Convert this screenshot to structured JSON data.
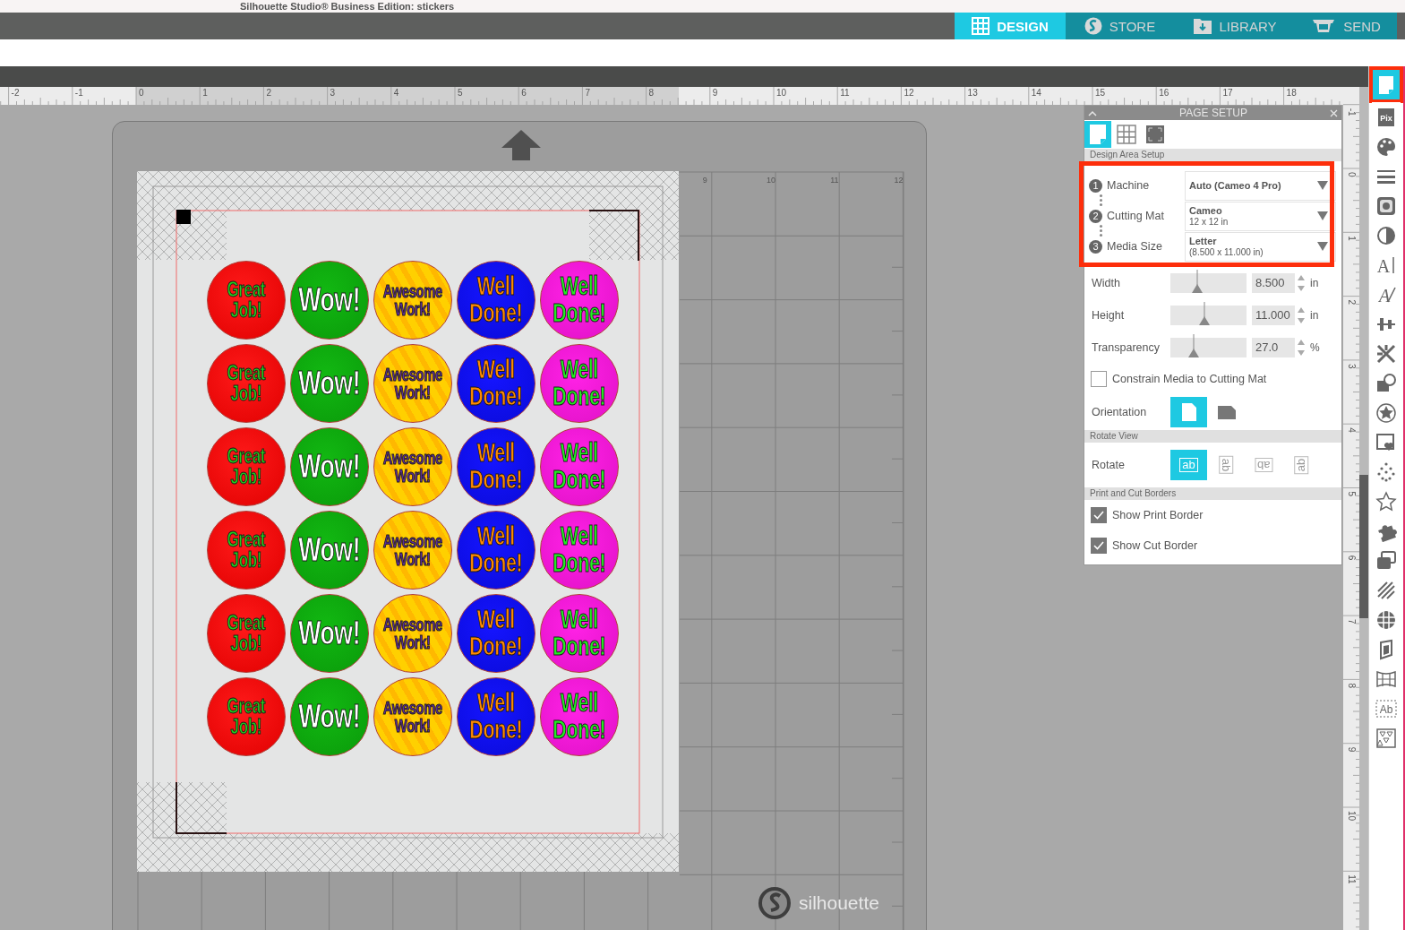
{
  "title": "Silhouette Studio® Business Edition: stickers",
  "nav_tabs": [
    {
      "label": "DESIGN",
      "kind": "design",
      "selected": true
    },
    {
      "label": "STORE",
      "kind": "store",
      "selected": false
    },
    {
      "label": "LIBRARY",
      "kind": "library",
      "selected": false
    },
    {
      "label": "SEND",
      "kind": "send",
      "selected": false
    }
  ],
  "ruler": {
    "labels": [
      "-2",
      "-1",
      "0",
      "1",
      "2",
      "3",
      "4",
      "5",
      "6",
      "7",
      "8",
      "9",
      "10",
      "11",
      "12",
      "13",
      "14",
      "15",
      "16",
      "17",
      "18"
    ]
  },
  "vertical_ruler": {
    "labels": [
      "-1",
      "0",
      "1",
      "2",
      "3",
      "4",
      "5",
      "6",
      "7",
      "8",
      "9",
      "10",
      "11"
    ]
  },
  "mat": {
    "column_labels": [
      "9",
      "10",
      "11",
      "12"
    ],
    "logo_text": "silhouette",
    "stickers": [
      [
        {
          "kind": "great",
          "lines": [
            "Great",
            "Job!"
          ]
        },
        {
          "kind": "wow",
          "lines": [
            "Wow!"
          ]
        },
        {
          "kind": "awesome",
          "lines": [
            "Awesome",
            "Work!"
          ]
        },
        {
          "kind": "well-blue",
          "lines": [
            "Well",
            "Done!"
          ]
        },
        {
          "kind": "well-pink",
          "lines": [
            "Well",
            "Done!"
          ]
        }
      ],
      [
        {
          "kind": "great",
          "lines": [
            "Great",
            "Job!"
          ]
        },
        {
          "kind": "wow",
          "lines": [
            "Wow!"
          ]
        },
        {
          "kind": "awesome",
          "lines": [
            "Awesome",
            "Work!"
          ]
        },
        {
          "kind": "well-blue",
          "lines": [
            "Well",
            "Done!"
          ]
        },
        {
          "kind": "well-pink",
          "lines": [
            "Well",
            "Done!"
          ]
        }
      ],
      [
        {
          "kind": "great",
          "lines": [
            "Great",
            "Job!"
          ]
        },
        {
          "kind": "wow",
          "lines": [
            "Wow!"
          ]
        },
        {
          "kind": "awesome",
          "lines": [
            "Awesome",
            "Work!"
          ]
        },
        {
          "kind": "well-blue",
          "lines": [
            "Well",
            "Done!"
          ]
        },
        {
          "kind": "well-pink",
          "lines": [
            "Well",
            "Done!"
          ]
        }
      ],
      [
        {
          "kind": "great",
          "lines": [
            "Great",
            "Job!"
          ]
        },
        {
          "kind": "wow",
          "lines": [
            "Wow!"
          ]
        },
        {
          "kind": "awesome",
          "lines": [
            "Awesome",
            "Work!"
          ]
        },
        {
          "kind": "well-blue",
          "lines": [
            "Well",
            "Done!"
          ]
        },
        {
          "kind": "well-pink",
          "lines": [
            "Well",
            "Done!"
          ]
        }
      ],
      [
        {
          "kind": "great",
          "lines": [
            "Great",
            "Job!"
          ]
        },
        {
          "kind": "wow",
          "lines": [
            "Wow!"
          ]
        },
        {
          "kind": "awesome",
          "lines": [
            "Awesome",
            "Work!"
          ]
        },
        {
          "kind": "well-blue",
          "lines": [
            "Well",
            "Done!"
          ]
        },
        {
          "kind": "well-pink",
          "lines": [
            "Well",
            "Done!"
          ]
        }
      ],
      [
        {
          "kind": "great",
          "lines": [
            "Great",
            "Job!"
          ]
        },
        {
          "kind": "wow",
          "lines": [
            "Wow!"
          ]
        },
        {
          "kind": "awesome",
          "lines": [
            "Awesome",
            "Work!"
          ]
        },
        {
          "kind": "well-blue",
          "lines": [
            "Well",
            "Done!"
          ]
        },
        {
          "kind": "well-pink",
          "lines": [
            "Well",
            "Done!"
          ]
        }
      ]
    ]
  },
  "page_setup": {
    "title": "PAGE SETUP",
    "tabs": [
      {
        "kind": "page",
        "selected": true
      },
      {
        "kind": "grid",
        "selected": false
      },
      {
        "kind": "frame",
        "selected": false
      }
    ],
    "section": "Design Area Setup",
    "highlighted": true,
    "steps": [
      {
        "number": "1",
        "label": "Machine",
        "value_lines": [
          "Auto (Cameo 4 Pro)"
        ]
      },
      {
        "number": "2",
        "label": "Cutting Mat",
        "value_lines": [
          "Cameo",
          "12 x 12 in"
        ]
      },
      {
        "number": "3",
        "label": "Media Size",
        "value_lines": [
          "Letter",
          "(8.500 x 11.000 in)"
        ]
      }
    ],
    "sliders": [
      {
        "label": "Width",
        "level": 0.35,
        "value": "8.500",
        "unit": "in"
      },
      {
        "label": "Height",
        "level": 0.45,
        "value": "11.000",
        "unit": "in"
      },
      {
        "label": "Transparency",
        "level": 0.3,
        "value": "27.0",
        "unit": "%"
      }
    ],
    "constrain": {
      "label": "Constrain Media to Cutting Mat",
      "checked": false
    },
    "orientation": {
      "label": "Orientation",
      "options": [
        {
          "kind": "portrait",
          "selected": true
        },
        {
          "kind": "landscape",
          "selected": false
        }
      ]
    },
    "rotate_view": {
      "heading": "Rotate View",
      "label": "Rotate",
      "options": [
        {
          "text": "ab",
          "selected": true
        },
        {
          "text": "ab",
          "selected": false
        },
        {
          "text": "ab",
          "selected": false
        },
        {
          "text": "ab",
          "selected": false
        }
      ]
    },
    "borders": {
      "heading": "Print and Cut Borders",
      "options": [
        {
          "label": "Show Print Border",
          "checked": true
        },
        {
          "label": "Show Cut Border",
          "checked": true
        }
      ]
    }
  },
  "toolbar": [
    {
      "kind": "page",
      "selected": true,
      "highlighted": true
    },
    {
      "kind": "pix",
      "glyph": "Pix",
      "selected": false
    },
    {
      "kind": "palette",
      "selected": false
    },
    {
      "kind": "lines",
      "selected": false
    },
    {
      "kind": "tile",
      "selected": false
    },
    {
      "kind": "contrast",
      "selected": false
    },
    {
      "kind": "text",
      "glyph": "A",
      "selected": false
    },
    {
      "kind": "sketch",
      "glyph": "A",
      "selected": false
    },
    {
      "kind": "align",
      "selected": false
    },
    {
      "kind": "knife",
      "selected": false
    },
    {
      "kind": "shapes",
      "selected": false
    },
    {
      "kind": "star-badge",
      "selected": false
    },
    {
      "kind": "heart-card",
      "selected": false
    },
    {
      "kind": "dots",
      "selected": false
    },
    {
      "kind": "star",
      "selected": false
    },
    {
      "kind": "puzzle",
      "selected": false
    },
    {
      "kind": "layers",
      "selected": false
    },
    {
      "kind": "hatch",
      "selected": false
    },
    {
      "kind": "globe",
      "selected": false
    },
    {
      "kind": "cube",
      "selected": false
    },
    {
      "kind": "warp",
      "selected": false
    },
    {
      "kind": "text-box",
      "glyph": "Ab",
      "selected": false
    },
    {
      "kind": "triangles",
      "selected": false
    }
  ]
}
